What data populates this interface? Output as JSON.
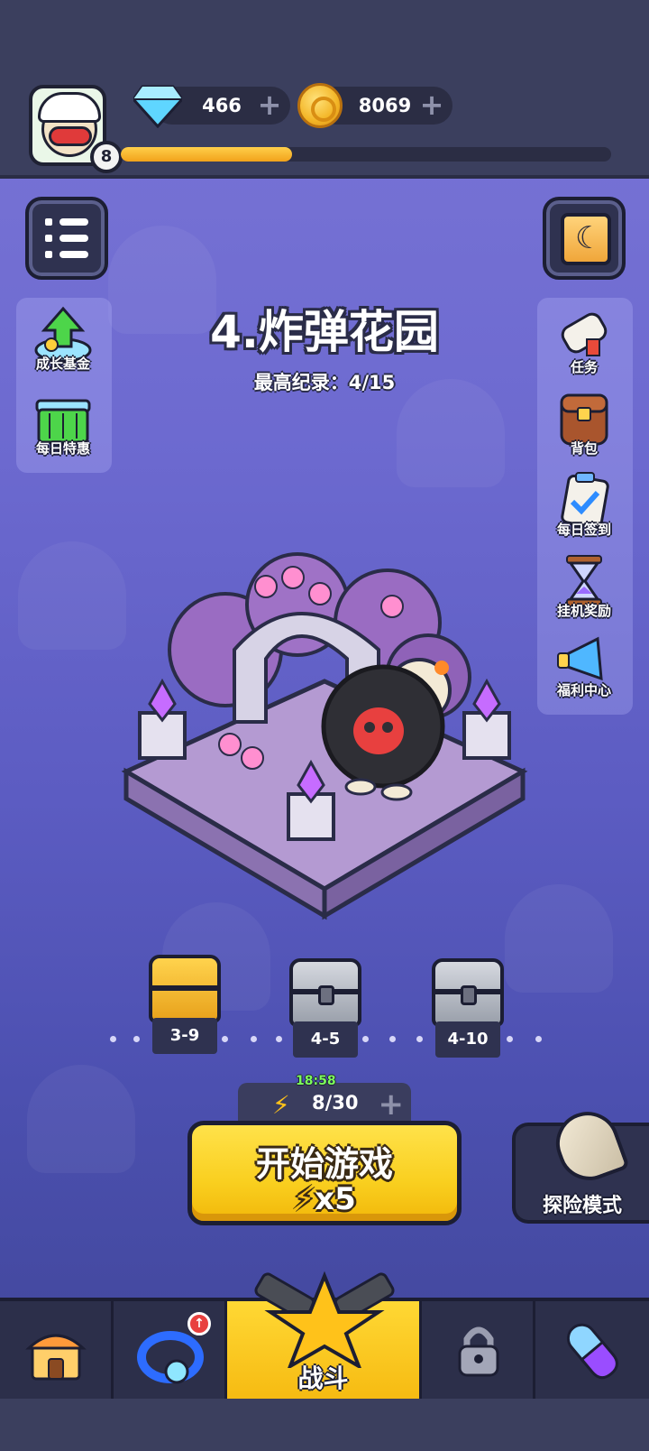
{
  "currency": {
    "gems": "466",
    "coins": "8069"
  },
  "player": {
    "level": "8",
    "xp_progress": 0.35
  },
  "stage": {
    "title": "4.炸弹花园",
    "record": "最高纪录：4/15"
  },
  "left_panel": {
    "items": [
      {
        "label": "成长基金",
        "icon": "growth-fund-icon"
      },
      {
        "label": "每日特惠",
        "icon": "daily-deal-basket-icon"
      }
    ]
  },
  "right_panel": {
    "items": [
      {
        "label": "任务",
        "icon": "scroll-icon"
      },
      {
        "label": "背包",
        "icon": "backpack-icon"
      },
      {
        "label": "每日签到",
        "icon": "clipboard-check-icon"
      },
      {
        "label": "挂机奖励",
        "icon": "hourglass-icon"
      },
      {
        "label": "福利中心",
        "icon": "megaphone-icon"
      }
    ]
  },
  "chests": [
    {
      "label": "3-9",
      "state": "unlocked"
    },
    {
      "label": "4-5",
      "state": "locked"
    },
    {
      "label": "4-10",
      "state": "locked"
    }
  ],
  "energy": {
    "timer": "18:58",
    "count": "8/30"
  },
  "start_button": {
    "label": "开始游戏",
    "cost": "x5"
  },
  "adventure_button": {
    "label": "探险模式"
  },
  "bottom_nav": {
    "battle_label": "战斗"
  },
  "colors": {
    "accent": "#f9cf1f",
    "background": "#6d6ad0",
    "bar": "#2f3250"
  }
}
